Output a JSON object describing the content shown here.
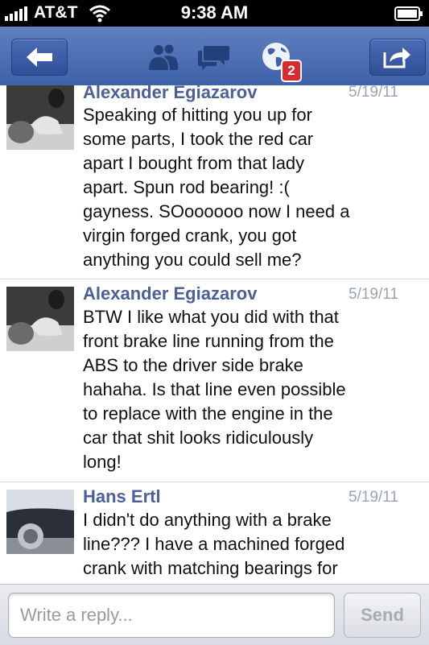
{
  "status": {
    "carrier": "AT&T",
    "time": "9:38 AM"
  },
  "nav": {
    "notification_count": "2"
  },
  "posts": [
    {
      "author": "Alexander Egiazarov",
      "date": "5/19/11",
      "lines": [
        "Speaking of hitting you up for",
        "some parts, I took the red car",
        "apart I bought from that lady",
        "apart. Spun rod bearing! :(",
        "gayness. SOoooooo now I need a",
        "virgin forged crank, you got",
        "anything you could sell me?"
      ]
    },
    {
      "author": "Alexander Egiazarov",
      "date": "5/19/11",
      "lines": [
        "BTW I like what you did with that",
        "front brake line running from the",
        "ABS to the driver side brake",
        "hahaha. Is that line even possible",
        "to replace with the engine in the",
        "car that shit looks ridiculously",
        "long!"
      ]
    },
    {
      "author": "Hans Ertl",
      "date": "5/19/11",
      "lines": [
        "I didn't do anything with a brake",
        "line???  I have a machined forged",
        "crank with matching bearings for"
      ]
    }
  ],
  "reply": {
    "placeholder": "Write a reply...",
    "send_label": "Send"
  },
  "colors": {
    "nav_blue": "#3f61a8",
    "author_blue": "#4b6096",
    "date_gray": "#9aa3b5",
    "badge_red": "#d92b2b"
  }
}
